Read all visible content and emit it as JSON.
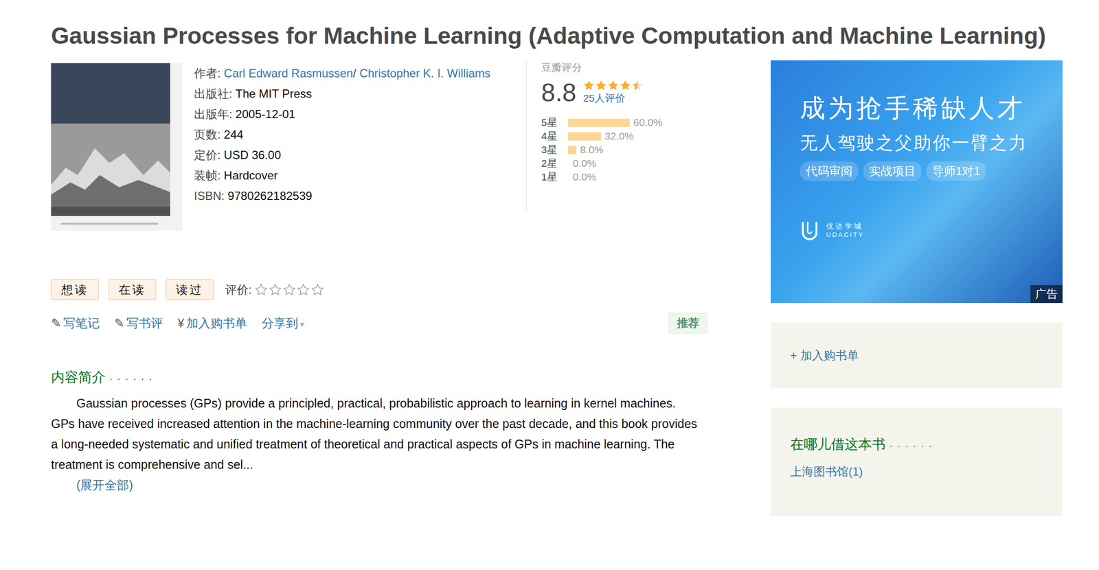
{
  "title": "Gaussian Processes for Machine Learning (Adaptive Computation and Machine Learning)",
  "book": {
    "authors_label": "作者:",
    "authors": [
      "Carl Edward Rasmussen",
      "Christopher K. I. Williams"
    ],
    "author_sep": "/",
    "fields": [
      {
        "label": "出版社:",
        "value": "The MIT Press"
      },
      {
        "label": "出版年:",
        "value": "2005-12-01"
      },
      {
        "label": "页数:",
        "value": "244"
      },
      {
        "label": "定价:",
        "value": "USD 36.00"
      },
      {
        "label": "装帧:",
        "value": "Hardcover"
      },
      {
        "label": "ISBN:",
        "value": "9780262182539"
      }
    ]
  },
  "rating": {
    "label": "豆瓣评分",
    "score": "8.8",
    "stars": 4.5,
    "count": "25人评价",
    "dist": [
      {
        "label": "5星",
        "pct": "60.0%",
        "level": 0.6
      },
      {
        "label": "4星",
        "pct": "32.0%",
        "level": 0.32
      },
      {
        "label": "3星",
        "pct": "8.0%",
        "level": 0.08
      },
      {
        "label": "2星",
        "pct": "0.0%",
        "level": 0
      },
      {
        "label": "1星",
        "pct": "0.0%",
        "level": 0
      }
    ]
  },
  "actions": {
    "buttons": [
      "想读",
      "在读",
      "读过"
    ],
    "rate_label": "评价:",
    "user_stars": 0,
    "links": [
      {
        "icon": "✎",
        "label": "写笔记"
      },
      {
        "icon": "✎",
        "label": "写书评"
      },
      {
        "icon": "¥",
        "label": "加入购书单"
      }
    ],
    "share": {
      "label": "分享到",
      "icon": "▾"
    },
    "recommend": "推荐"
  },
  "intro": {
    "heading": "内容简介",
    "dots": "· · · · · ·",
    "text": "Gaussian processes (GPs) provide a principled, practical, probabilistic approach to learning in kernel machines. GPs have received increased attention in the machine-learning community over the past decade, and this book provides a long-needed systematic and unified treatment of theoretical and practical aspects of GPs in machine learning. The treatment is comprehensive and sel...",
    "expand": "(展开全部)"
  },
  "ad": {
    "headline": "成为抢手稀缺人才",
    "sub": "无人驾驶之父助你一臂之力",
    "tags": [
      "代码审阅",
      "实战项目",
      "导师1对1"
    ],
    "brand_cn": "优达学城",
    "brand_en": "UDACITY",
    "badge": "广告"
  },
  "cart": {
    "icon": "+",
    "label": "加入购书单"
  },
  "borrow": {
    "heading": "在哪儿借这本书",
    "dots": "· · · · · ·",
    "libraries": [
      "上海图书馆(1)"
    ]
  }
}
